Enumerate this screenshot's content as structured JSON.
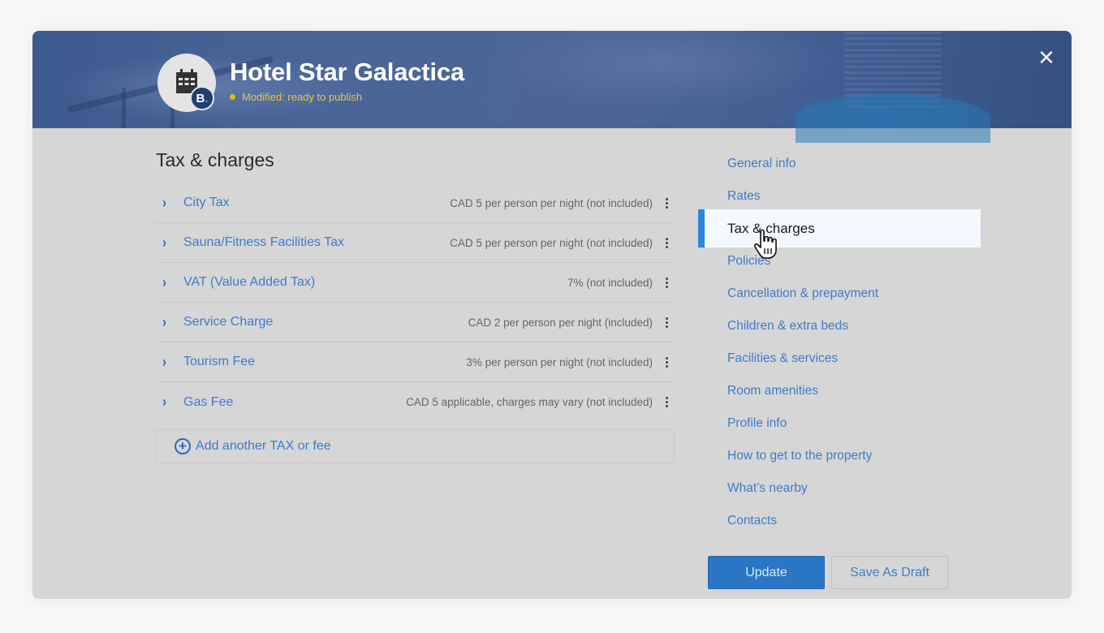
{
  "header": {
    "hotel_name": "Hotel Star Galactica",
    "status": "Modified: ready to publish",
    "badge_letter": "B",
    "badge_dot": ".",
    "close_glyph": "✕",
    "avatar_icon": "hotel-building-icon"
  },
  "main": {
    "title": "Tax & charges",
    "taxes": [
      {
        "name": "City Tax",
        "value": "CAD 5 per person per night (not included)"
      },
      {
        "name": "Sauna/Fitness Facilities Tax",
        "value": "CAD 5 per person per night (not included)"
      },
      {
        "name": "VAT (Value Added Tax)",
        "value": "7% (not included)"
      },
      {
        "name": "Service Charge",
        "value": "CAD 2 per person per night (included)"
      },
      {
        "name": "Tourism Fee",
        "value": "3% per person per night (not included)"
      },
      {
        "name": "Gas Fee",
        "value": "CAD 5 applicable, charges may vary (not included)"
      }
    ],
    "chevron_glyph": "›",
    "add_label": "Add another TAX or fee",
    "add_glyph": "+"
  },
  "nav": {
    "active_index": 2,
    "items": [
      {
        "label": "General info"
      },
      {
        "label": "Rates"
      },
      {
        "label": "Tax & charges"
      },
      {
        "label": "Policies"
      },
      {
        "label": "Cancellation & prepayment"
      },
      {
        "label": "Children & extra beds"
      },
      {
        "label": "Facilities & services"
      },
      {
        "label": "Room amenities"
      },
      {
        "label": "Profile info"
      },
      {
        "label": "How to get to the property"
      },
      {
        "label": "What’s nearby"
      },
      {
        "label": "Contacts"
      }
    ]
  },
  "actions": {
    "update_label": "Update",
    "draft_label": "Save As Draft"
  },
  "colors": {
    "accent": "#2a76c4",
    "link": "#3d7ccc",
    "status": "#f0c43c",
    "active_bar": "#2a86df"
  }
}
